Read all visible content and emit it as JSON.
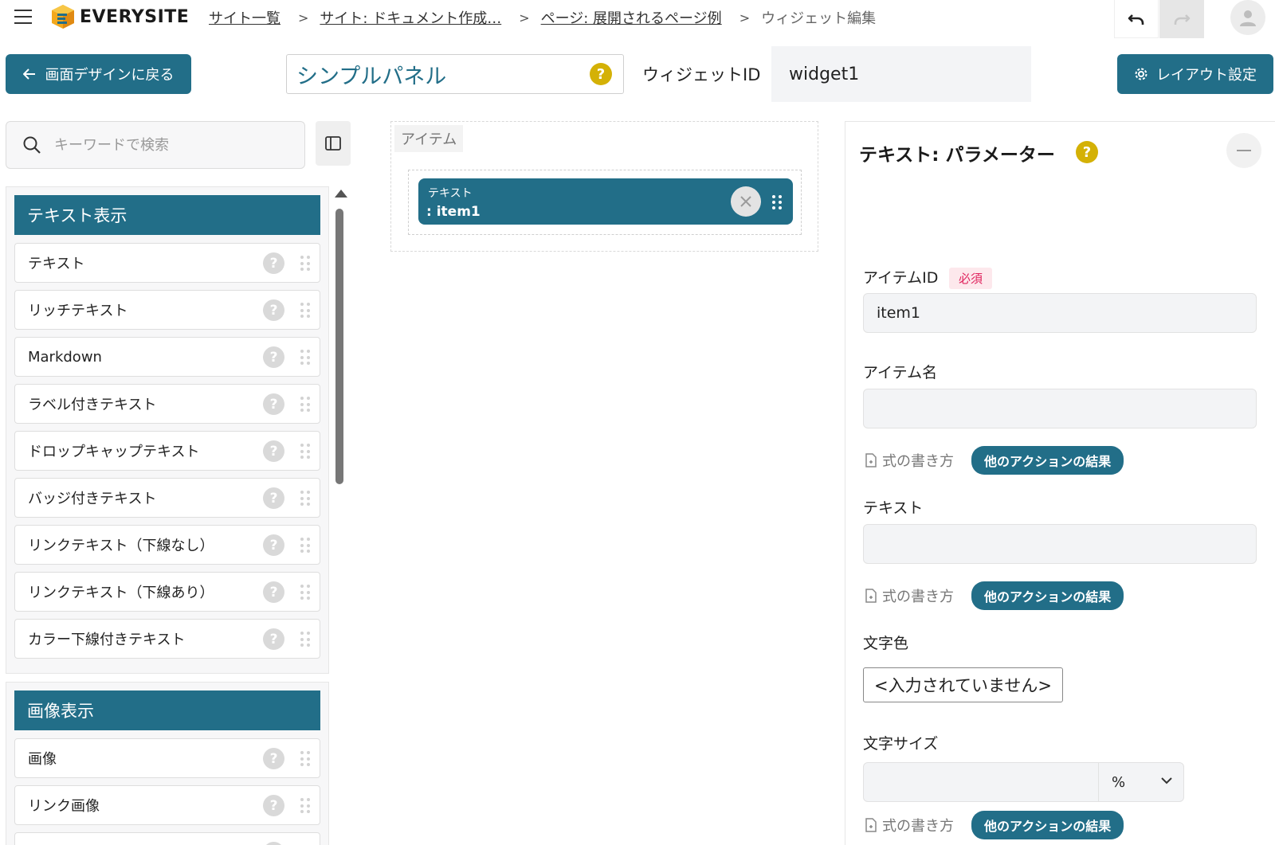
{
  "header": {
    "logo_text": "EVERYSITE",
    "breadcrumb": [
      {
        "label": "サイト一覧"
      },
      {
        "label": "サイト: ドキュメント作成…"
      },
      {
        "label": "ページ: 展開されるページ例"
      }
    ],
    "current": "ウィジェット編集",
    "icons": {
      "menu": "hamburger-icon",
      "undo": "undo-icon",
      "redo": "redo-icon",
      "user": "user-icon"
    }
  },
  "toolbar": {
    "back_label": "画面デザインに戻る",
    "widget_title": "シンプルパネル",
    "help_glyph": "?",
    "widget_id_label": "ウィジェットID",
    "widget_id_value": "widget1",
    "layout_label": "レイアウト設定"
  },
  "palette": {
    "search_placeholder": "キーワードで検索",
    "groups": [
      {
        "title": "テキスト表示",
        "items": [
          "テキスト",
          "リッチテキスト",
          "Markdown",
          "ラベル付きテキスト",
          "ドロップキャップテキスト",
          "バッジ付きテキスト",
          "リンクテキスト（下線なし）",
          "リンクテキスト（下線あり）",
          "カラー下線付きテキスト"
        ]
      },
      {
        "title": "画像表示",
        "items": [
          "画像",
          "リンク画像"
        ]
      }
    ]
  },
  "canvas": {
    "section_label": "アイテム",
    "item_type": "テキスト",
    "item_id": ": item1"
  },
  "params": {
    "title": "テキスト: パラメーター",
    "item_id_label": "アイテムID",
    "required_badge": "必須",
    "item_id_value": "item1",
    "item_name_label": "アイテム名",
    "item_name_value": "",
    "text_label": "テキスト",
    "text_value": "",
    "formula_link": "式の書き方",
    "action_pill": "他のアクションの結果",
    "color_label": "文字色",
    "color_value": "<入力されていません>",
    "size_label": "文字サイズ",
    "size_value": "",
    "size_unit": "%"
  },
  "colors": {
    "accent": "#226e88",
    "help_yellow": "#d4b106",
    "required": "#e0245e"
  }
}
